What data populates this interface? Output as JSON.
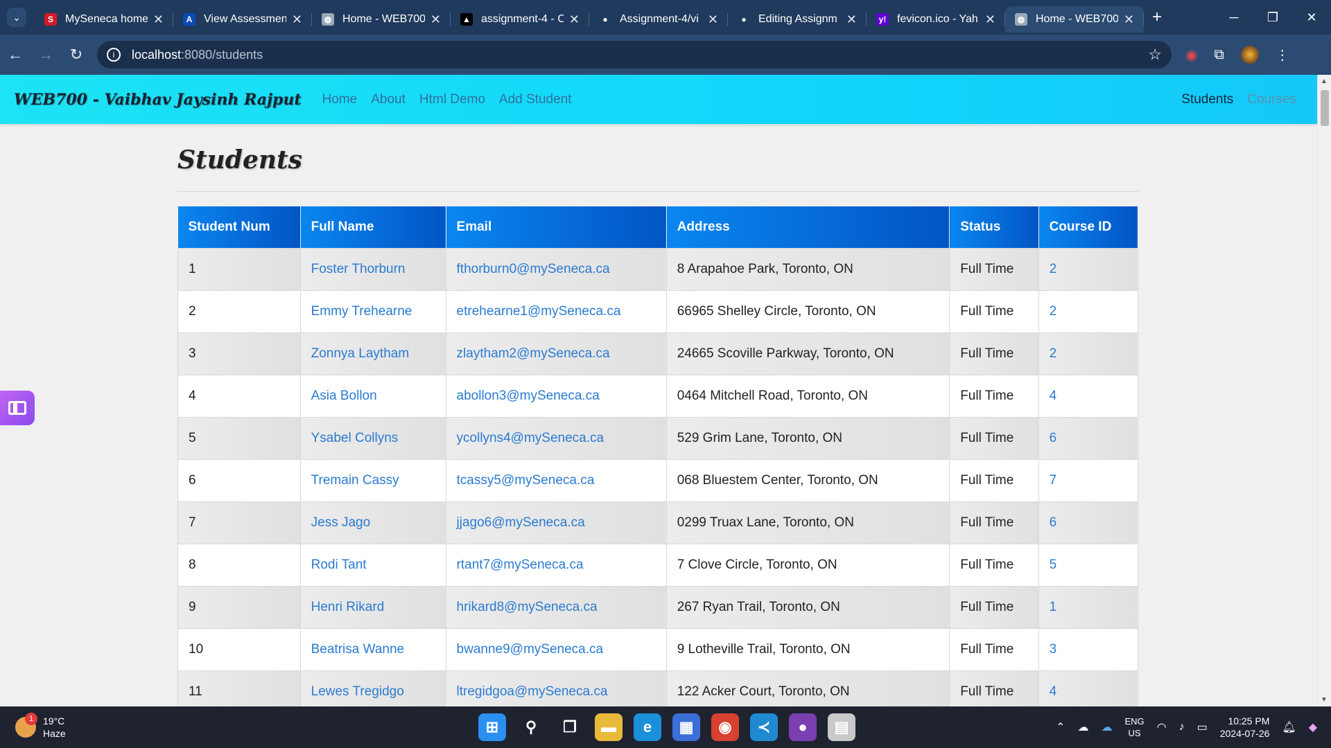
{
  "browser": {
    "tabs": [
      {
        "label": "MySeneca home",
        "icon": "seneca-icon",
        "color": "#d11a2a",
        "glyph": "S"
      },
      {
        "label": "View Assessment",
        "icon": "assessment-icon",
        "color": "#0a4bb3",
        "glyph": "A"
      },
      {
        "label": "Home - WEB700",
        "icon": "globe-icon",
        "color": "#9aa8b8",
        "glyph": "◍"
      },
      {
        "label": "assignment-4 - C",
        "icon": "vercel-icon",
        "color": "#000000",
        "glyph": "▲"
      },
      {
        "label": "Assignment-4/vi",
        "icon": "github-icon",
        "color": "#ffffff",
        "glyph": "●"
      },
      {
        "label": "Editing Assignm",
        "icon": "github-icon",
        "color": "#ffffff",
        "glyph": "●"
      },
      {
        "label": "fevicon.ico - Yah",
        "icon": "yahoo-icon",
        "color": "#6001d2",
        "glyph": "y!"
      },
      {
        "label": "Home - WEB700",
        "icon": "globe-icon",
        "color": "#9aa8b8",
        "glyph": "◍",
        "active": true
      }
    ],
    "address": {
      "host": "localhost",
      "path": ":8080/students"
    }
  },
  "navbar": {
    "brand": "WEB700 - Vaibhav Jaysinh Rajput",
    "links": [
      "Home",
      "About",
      "Html Demo",
      "Add Student"
    ],
    "right": {
      "active": "Students",
      "inactive": "Courses"
    }
  },
  "page": {
    "title": "Students",
    "columns": [
      "Student Num",
      "Full Name",
      "Email",
      "Address",
      "Status",
      "Course ID"
    ],
    "rows": [
      [
        "1",
        "Foster Thorburn",
        "fthorburn0@mySeneca.ca",
        "8 Arapahoe Park, Toronto, ON",
        "Full Time",
        "2"
      ],
      [
        "2",
        "Emmy Trehearne",
        "etrehearne1@mySeneca.ca",
        "66965 Shelley Circle, Toronto, ON",
        "Full Time",
        "2"
      ],
      [
        "3",
        "Zonnya Laytham",
        "zlaytham2@mySeneca.ca",
        "24665 Scoville Parkway, Toronto, ON",
        "Full Time",
        "2"
      ],
      [
        "4",
        "Asia Bollon",
        "abollon3@mySeneca.ca",
        "0464 Mitchell Road, Toronto, ON",
        "Full Time",
        "4"
      ],
      [
        "5",
        "Ysabel Collyns",
        "ycollyns4@mySeneca.ca",
        "529 Grim Lane, Toronto, ON",
        "Full Time",
        "6"
      ],
      [
        "6",
        "Tremain Cassy",
        "tcassy5@mySeneca.ca",
        "068 Bluestem Center, Toronto, ON",
        "Full Time",
        "7"
      ],
      [
        "7",
        "Jess Jago",
        "jjago6@mySeneca.ca",
        "0299 Truax Lane, Toronto, ON",
        "Full Time",
        "6"
      ],
      [
        "8",
        "Rodi Tant",
        "rtant7@mySeneca.ca",
        "7 Clove Circle, Toronto, ON",
        "Full Time",
        "5"
      ],
      [
        "9",
        "Henri Rikard",
        "hrikard8@mySeneca.ca",
        "267 Ryan Trail, Toronto, ON",
        "Full Time",
        "1"
      ],
      [
        "10",
        "Beatrisa Wanne",
        "bwanne9@mySeneca.ca",
        "9 Lotheville Trail, Toronto, ON",
        "Full Time",
        "3"
      ],
      [
        "11",
        "Lewes Tregidgo",
        "ltregidgoa@mySeneca.ca",
        "122 Acker Court, Toronto, ON",
        "Full Time",
        "4"
      ]
    ]
  },
  "taskbar": {
    "weather": {
      "temp": "19°C",
      "cond": "Haze",
      "badge": "1"
    },
    "apps": [
      {
        "name": "start-icon",
        "color": "#2b8ff0",
        "glyph": "⊞"
      },
      {
        "name": "search-icon",
        "color": "#1f2330",
        "glyph": "⚲"
      },
      {
        "name": "taskview-icon",
        "color": "#1f2330",
        "glyph": "❐"
      },
      {
        "name": "file-explorer-icon",
        "color": "#e9b93a",
        "glyph": "▬"
      },
      {
        "name": "edge-icon",
        "color": "#1b8fd8",
        "glyph": "e"
      },
      {
        "name": "store-icon",
        "color": "#3a6fd8",
        "glyph": "▦"
      },
      {
        "name": "chrome-icon",
        "color": "#d8412f",
        "glyph": "◉"
      },
      {
        "name": "vscode-icon",
        "color": "#1f8ad2",
        "glyph": "≺"
      },
      {
        "name": "github-desktop-icon",
        "color": "#7a3fb0",
        "glyph": "●"
      },
      {
        "name": "app-icon",
        "color": "#c9c9c9",
        "glyph": "▤"
      }
    ],
    "lang": [
      "ENG",
      "US"
    ],
    "time": "10:25 PM",
    "date": "2024-07-26"
  }
}
